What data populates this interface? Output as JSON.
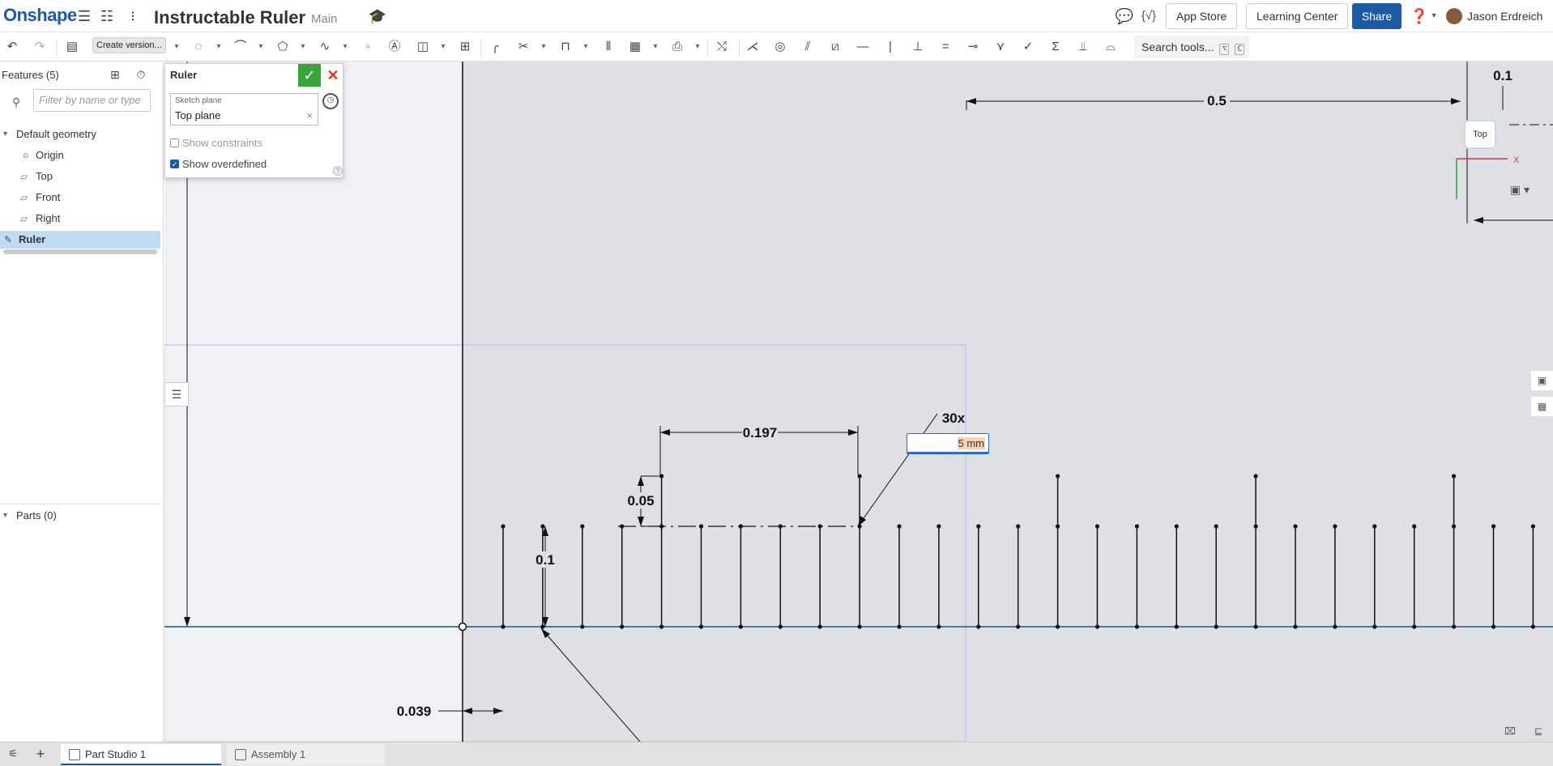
{
  "app": {
    "logo": "Onshape",
    "doc_title": "Instructable Ruler",
    "branch": "Main"
  },
  "topbar": {
    "app_store": "App Store",
    "learning_center": "Learning Center",
    "share": "Share",
    "user": "Jason Erdreich"
  },
  "toolbar": {
    "tooltip": "Create version...",
    "search": "Search tools...",
    "search_keys": [
      "⌥",
      "C"
    ]
  },
  "features": {
    "header": "Features (5)",
    "filter_placeholder": "Filter by name or type",
    "items": [
      {
        "label": "Default geometry"
      },
      {
        "label": "Origin"
      },
      {
        "label": "Top"
      },
      {
        "label": "Front"
      },
      {
        "label": "Right"
      },
      {
        "label": "Ruler"
      }
    ],
    "parts": "Parts (0)"
  },
  "dialog": {
    "title": "Ruler",
    "sketch_plane_label": "Sketch plane",
    "sketch_plane_value": "Top plane",
    "show_constraints": "Show constraints",
    "show_overdefined": "Show overdefined"
  },
  "canvas": {
    "dim_input_value": "5 mm",
    "dims": {
      "d1": "0.5",
      "d2": "0.1",
      "d3": "0.197",
      "d4": "0.05",
      "d5": "0.1",
      "d6": "0.039",
      "d7": "30x"
    },
    "viewcube_label": "Top",
    "axis_x": "X"
  },
  "tabs": [
    {
      "label": "Part Studio 1",
      "active": true
    },
    {
      "label": "Assembly 1",
      "active": false
    }
  ]
}
